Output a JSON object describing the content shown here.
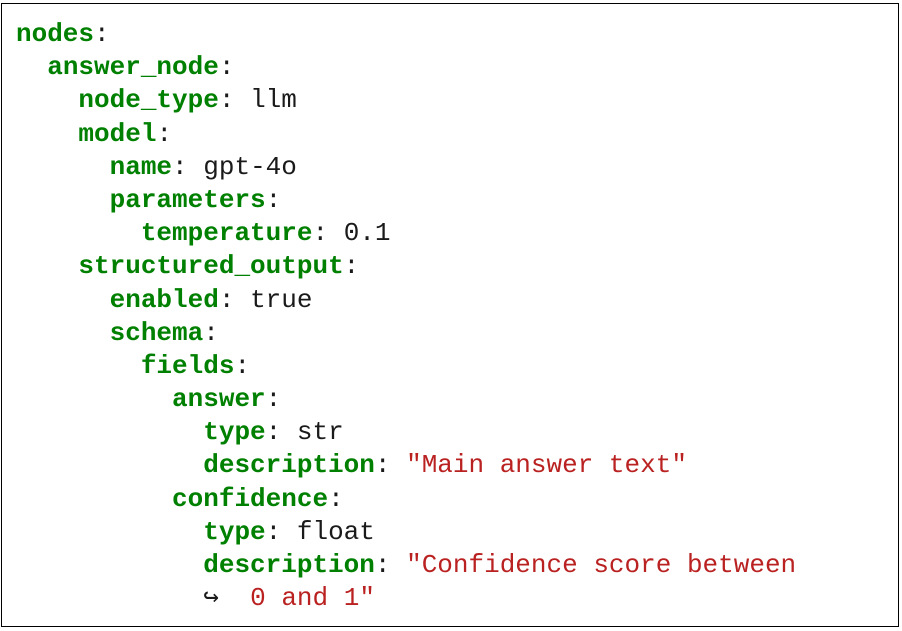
{
  "code": {
    "lines": [
      {
        "indent": 0,
        "key": "nodes",
        "sep": ":",
        "value": "",
        "kind": "none"
      },
      {
        "indent": 1,
        "key": "answer_node",
        "sep": ":",
        "value": "",
        "kind": "none"
      },
      {
        "indent": 2,
        "key": "node_type",
        "sep": ":",
        "value": "llm",
        "kind": "val"
      },
      {
        "indent": 2,
        "key": "model",
        "sep": ":",
        "value": "",
        "kind": "none"
      },
      {
        "indent": 3,
        "key": "name",
        "sep": ":",
        "value": "gpt-4o",
        "kind": "val"
      },
      {
        "indent": 3,
        "key": "parameters",
        "sep": ":",
        "value": "",
        "kind": "none"
      },
      {
        "indent": 4,
        "key": "temperature",
        "sep": ":",
        "value": "0.1",
        "kind": "val"
      },
      {
        "indent": 2,
        "key": "structured_output",
        "sep": ":",
        "value": "",
        "kind": "none"
      },
      {
        "indent": 3,
        "key": "enabled",
        "sep": ":",
        "value": "true",
        "kind": "val"
      },
      {
        "indent": 3,
        "key": "schema",
        "sep": ":",
        "value": "",
        "kind": "none"
      },
      {
        "indent": 4,
        "key": "fields",
        "sep": ":",
        "value": "",
        "kind": "none"
      },
      {
        "indent": 5,
        "key": "answer",
        "sep": ":",
        "value": "",
        "kind": "none"
      },
      {
        "indent": 6,
        "key": "type",
        "sep": ":",
        "value": "str",
        "kind": "val"
      },
      {
        "indent": 6,
        "key": "description",
        "sep": ":",
        "value": "\"Main answer text\"",
        "kind": "str"
      },
      {
        "indent": 5,
        "key": "confidence",
        "sep": ":",
        "value": "",
        "kind": "none"
      },
      {
        "indent": 6,
        "key": "type",
        "sep": ":",
        "value": "float",
        "kind": "val"
      },
      {
        "indent": 6,
        "key": "description",
        "sep": ":",
        "value": "\"Confidence score between",
        "kind": "str"
      },
      {
        "indent": 6,
        "key": "",
        "sep": "",
        "value": "0 and 1\"",
        "kind": "str",
        "wrap": "↪"
      }
    ]
  }
}
